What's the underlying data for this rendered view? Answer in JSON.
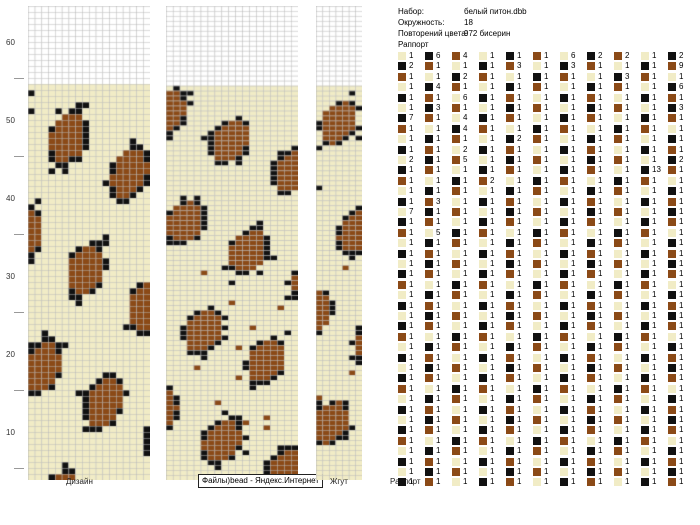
{
  "ruler": {
    "ticks": [
      "60",
      "50",
      "40",
      "30",
      "20",
      "10"
    ]
  },
  "panels": {
    "design_label": "Дизайн",
    "tube_label": "Жгут",
    "rapport_label": "Раппорт"
  },
  "tooltip": "Файлы)bead - Яндекс.Интернет",
  "info": {
    "set_key": "Набор:",
    "set_value": "белый питон.dbb",
    "circ_key": "Окружность:",
    "circ_value": "18",
    "repeat_key": "Повторений цвета:",
    "repeat_value": "972 бисерин",
    "rapport_heading": "Раппорт"
  },
  "colors": {
    "cream": "#f1ecc6",
    "brown": "#8b4a17",
    "black": "#111111",
    "white": "#ffffff",
    "grid": "#b9b9b9"
  },
  "rapport_counts": [
    [
      "1",
      "2",
      "1",
      "1",
      "1",
      "1",
      "7",
      "1",
      "1",
      "1",
      "2",
      "1",
      "1",
      "1",
      "1",
      "7",
      "1",
      "1",
      "1",
      "1",
      "1",
      "1",
      "1",
      "1",
      "1",
      "1",
      "1",
      "1",
      "1",
      "1",
      "1",
      "1",
      "1",
      "1",
      "1",
      "1",
      "1",
      "1",
      "1",
      "1",
      "1",
      "1"
    ],
    [
      "6",
      "1",
      "1",
      "4",
      "1",
      "3",
      "1",
      "1",
      "1",
      "1",
      "1",
      "1",
      "1",
      "1",
      "3",
      "1",
      "1",
      "5",
      "1",
      "1",
      "1",
      "1",
      "1",
      "1",
      "1",
      "1",
      "1",
      "1",
      "1",
      "1",
      "1",
      "1",
      "1",
      "1",
      "1",
      "1",
      "1",
      "1",
      "1",
      "1",
      "1",
      "1"
    ],
    [
      "4",
      "1",
      "2",
      "1",
      "6",
      "1",
      "4",
      "4",
      "1",
      "2",
      "5",
      "1",
      "1",
      "1",
      "1",
      "1",
      "1",
      "1",
      "1",
      "1",
      "1",
      "1",
      "1",
      "1",
      "1",
      "1",
      "1",
      "1",
      "1",
      "1",
      "1",
      "1",
      "1",
      "1",
      "1",
      "1",
      "1",
      "1",
      "1",
      "1",
      "1",
      "1"
    ],
    [
      "1",
      "1",
      "1",
      "1",
      "1",
      "1",
      "1",
      "1",
      "1",
      "1",
      "1",
      "1",
      "2",
      "1",
      "1",
      "1",
      "1",
      "1",
      "1",
      "1",
      "1",
      "1",
      "1",
      "1",
      "1",
      "1",
      "1",
      "1",
      "1",
      "1",
      "1",
      "1",
      "1",
      "1",
      "1",
      "1",
      "1",
      "1",
      "1",
      "1",
      "1",
      "1"
    ],
    [
      "1",
      "3",
      "1",
      "1",
      "1",
      "1",
      "1",
      "1",
      "2",
      "1",
      "1",
      "1",
      "1",
      "1",
      "1",
      "1",
      "1",
      "1",
      "1",
      "1",
      "1",
      "1",
      "1",
      "1",
      "1",
      "1",
      "1",
      "1",
      "1",
      "1",
      "1",
      "1",
      "1",
      "1",
      "1",
      "1",
      "1",
      "1",
      "1",
      "1",
      "1",
      "1"
    ],
    [
      "1",
      "1",
      "1",
      "1",
      "1",
      "1",
      "1",
      "1",
      "1",
      "1",
      "1",
      "1",
      "1",
      "1",
      "1",
      "1",
      "1",
      "1",
      "1",
      "1",
      "1",
      "1",
      "1",
      "1",
      "1",
      "1",
      "1",
      "1",
      "1",
      "1",
      "1",
      "1",
      "1",
      "1",
      "1",
      "1",
      "1",
      "1",
      "1",
      "1",
      "1",
      "1"
    ],
    [
      "6",
      "3",
      "1",
      "1",
      "1",
      "1",
      "1",
      "1",
      "1",
      "1",
      "1",
      "1",
      "1",
      "1",
      "1",
      "1",
      "1",
      "1",
      "1",
      "1",
      "1",
      "1",
      "1",
      "1",
      "1",
      "1",
      "1",
      "1",
      "1",
      "1",
      "1",
      "1",
      "1",
      "1",
      "1",
      "1",
      "1",
      "1",
      "1",
      "1",
      "1",
      "1"
    ],
    [
      "2",
      "1",
      "1",
      "1",
      "1",
      "1",
      "1",
      "1",
      "1",
      "1",
      "1",
      "1",
      "1",
      "1",
      "1",
      "1",
      "1",
      "1",
      "1",
      "1",
      "1",
      "1",
      "1",
      "1",
      "1",
      "1",
      "1",
      "1",
      "1",
      "1",
      "1",
      "1",
      "1",
      "1",
      "1",
      "1",
      "1",
      "1",
      "1",
      "1",
      "1",
      "1"
    ],
    [
      "2",
      "1",
      "3",
      "1",
      "1",
      "1",
      "1",
      "1",
      "1",
      "1",
      "1",
      "1",
      "1",
      "1",
      "1",
      "1",
      "1",
      "1",
      "1",
      "1",
      "1",
      "1",
      "1",
      "1",
      "1",
      "1",
      "1",
      "1",
      "1",
      "1",
      "1",
      "1",
      "1",
      "1",
      "1",
      "1",
      "1",
      "1",
      "1",
      "1",
      "1",
      "1"
    ],
    [
      "1",
      "1",
      "1",
      "1",
      "1",
      "1",
      "1",
      "1",
      "1",
      "1",
      "1",
      "13",
      "1",
      "1",
      "1",
      "1",
      "1",
      "1",
      "1",
      "1",
      "1",
      "1",
      "1",
      "1",
      "1",
      "1",
      "1",
      "1",
      "1",
      "1",
      "1",
      "1",
      "1",
      "1",
      "1",
      "1",
      "1",
      "1",
      "1",
      "1",
      "1",
      "1"
    ],
    [
      "2",
      "9",
      "1",
      "6",
      "1",
      "3",
      "1",
      "1",
      "1",
      "1",
      "2",
      "1",
      "1",
      "1",
      "1",
      "1",
      "1",
      "1",
      "1",
      "1",
      "1",
      "1",
      "1",
      "1",
      "1",
      "1",
      "1",
      "1",
      "1",
      "1",
      "1",
      "1",
      "1",
      "1",
      "1",
      "1",
      "1",
      "1",
      "1",
      "1",
      "1",
      "1"
    ]
  ]
}
